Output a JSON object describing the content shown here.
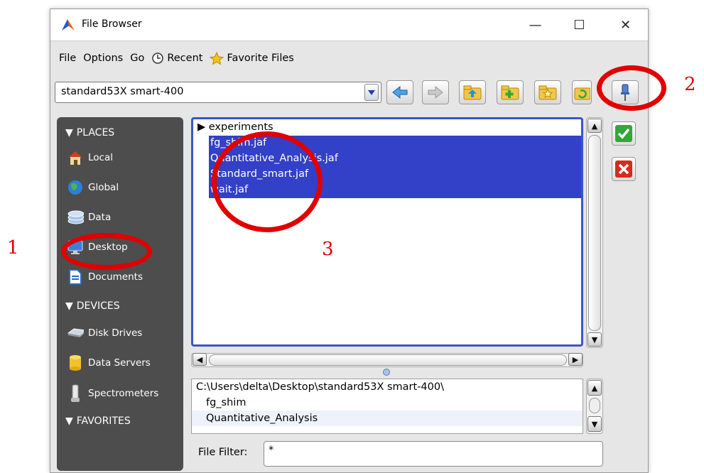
{
  "window": {
    "title": "File Browser",
    "minimize": "—",
    "maximize": "☐",
    "close": "✕"
  },
  "menubar": {
    "items": [
      "File",
      "Options",
      "Go",
      "Recent",
      "Favorite Files"
    ]
  },
  "toolbar": {
    "path_value": "standard53X smart-400"
  },
  "sidebar": {
    "places_label": "PLACES",
    "places": [
      "Local",
      "Global",
      "Data",
      "Desktop",
      "Documents"
    ],
    "devices_label": "DEVICES",
    "devices": [
      "Disk Drives",
      "Data Servers",
      "Spectrometers"
    ],
    "favorites_label": "FAVORITES"
  },
  "filelist": {
    "folder": "experiments",
    "files": [
      "fg_shim.jaf",
      "Quantitative_Analysis.jaf",
      "Standard_smart.jaf",
      "wait.jaf"
    ]
  },
  "details": {
    "path": "C:\\Users\\delta\\Desktop\\standard53X smart-400\\",
    "items": [
      "fg_shim",
      "Quantitative_Analysis"
    ]
  },
  "filter": {
    "label": "File Filter:",
    "value": "*"
  },
  "annotations": {
    "n1": "1",
    "n2": "2",
    "n3": "3"
  },
  "colors": {
    "selection": "#3340c8",
    "sidebar": "#4d4d4d",
    "annotation": "#e00000"
  }
}
